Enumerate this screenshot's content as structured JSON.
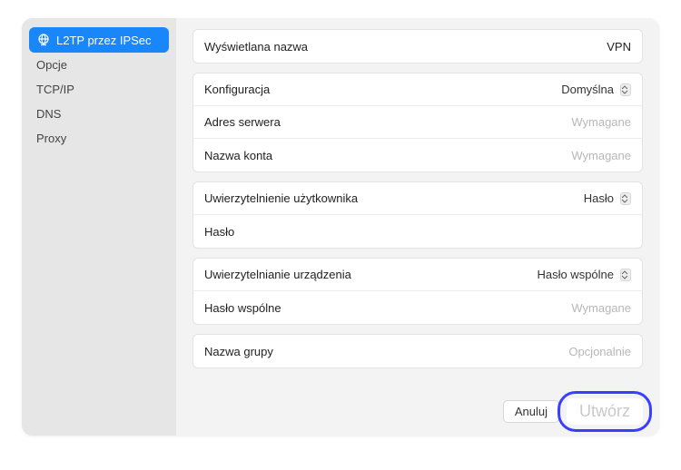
{
  "sidebar": {
    "items": [
      {
        "label": "L2TP przez IPSec",
        "active": true,
        "icon": "globe"
      },
      {
        "label": "Opcje",
        "active": false
      },
      {
        "label": "TCP/IP",
        "active": false
      },
      {
        "label": "DNS",
        "active": false
      },
      {
        "label": "Proxy",
        "active": false
      }
    ]
  },
  "fields": {
    "display_name_label": "Wyświetlana nazwa",
    "display_name_value": "VPN",
    "configuration_label": "Konfiguracja",
    "configuration_value": "Domyślna",
    "server_address_label": "Adres serwera",
    "server_address_placeholder": "Wymagane",
    "account_name_label": "Nazwa konta",
    "account_name_placeholder": "Wymagane",
    "user_auth_label": "Uwierzytelnienie użytkownika",
    "user_auth_value": "Hasło",
    "password_label": "Hasło",
    "device_auth_label": "Uwierzytelnianie urządzenia",
    "device_auth_value": "Hasło wspólne",
    "shared_password_label": "Hasło wspólne",
    "shared_password_placeholder": "Wymagane",
    "group_name_label": "Nazwa grupy",
    "group_name_placeholder": "Opcjonalnie"
  },
  "buttons": {
    "cancel": "Anuluj",
    "create": "Utwórz"
  }
}
